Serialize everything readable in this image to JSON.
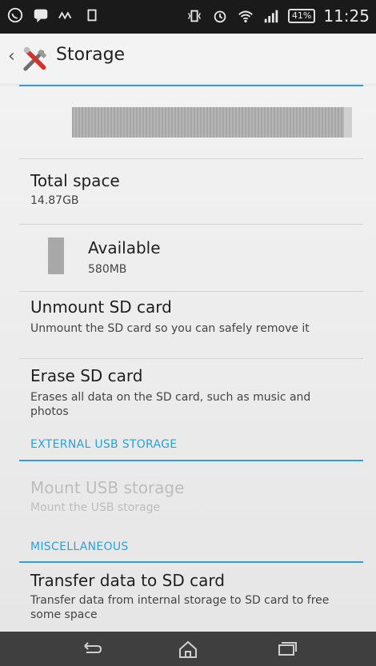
{
  "status_bar": {
    "icons_left": [
      "whatsapp-icon",
      "message-icon",
      "signal-wave-icon",
      "square-icon"
    ],
    "icons_right": [
      "vibrate-icon",
      "alarm-icon",
      "wifi-icon",
      "cell-signal-icon"
    ],
    "battery": "41%",
    "time": "11:25"
  },
  "action_bar": {
    "title": "Storage",
    "icon": "tools-icon",
    "accent": "#2f9fd6"
  },
  "storage": {
    "total_title": "Total space",
    "total_value": "14.87GB",
    "available_label": "Available",
    "available_value": "580MB"
  },
  "items": {
    "unmount_title": "Unmount SD card",
    "unmount_summary": "Unmount the SD card so you can safely remove it",
    "erase_title": "Erase SD card",
    "erase_summary": "Erases all data on the SD card, such as music and photos",
    "external_header": "EXTERNAL USB STORAGE",
    "mount_usb_title": "Mount USB storage",
    "mount_usb_summary": "Mount the USB storage",
    "misc_header": "MISCELLANEOUS",
    "transfer_title": "Transfer data to SD card",
    "transfer_summary": "Transfer data from internal storage to SD card to free some space"
  },
  "nav_bar": {
    "buttons": [
      "back-icon",
      "home-icon",
      "recent-apps-icon"
    ]
  }
}
